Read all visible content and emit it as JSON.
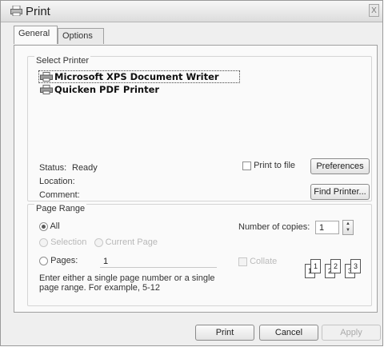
{
  "window": {
    "title": "Print",
    "close_label": "X"
  },
  "tabs": [
    {
      "label": "General",
      "active": true
    },
    {
      "label": "Options",
      "active": false
    }
  ],
  "select_printer": {
    "label": "Select Printer",
    "printers": [
      {
        "name": "Microsoft XPS Document Writer",
        "selected": true
      },
      {
        "name": "Quicken PDF Printer",
        "selected": false
      }
    ],
    "status_label": "Status:",
    "status_value": "Ready",
    "location_label": "Location:",
    "comment_label": "Comment:",
    "print_to_file_label": "Print to file",
    "preferences_label": "Preferences",
    "find_printer_label": "Find Printer..."
  },
  "page_range": {
    "label": "Page Range",
    "all_label": "All",
    "selection_label": "Selection",
    "current_page_label": "Current Page",
    "pages_label": "Pages:",
    "pages_value": "1",
    "hint": "Enter either a single page number or a single page range.  For example, 5-12",
    "selected": "all"
  },
  "copies": {
    "label": "Number of copies:",
    "value": "1",
    "collate_label": "Collate",
    "collate_sheets": [
      "1",
      "1",
      "2",
      "2",
      "3",
      "3"
    ]
  },
  "buttons": {
    "print": "Print",
    "cancel": "Cancel",
    "apply": "Apply"
  },
  "icons": {
    "title": "printer-icon",
    "printer": "printer-icon",
    "spin_up": "▲",
    "spin_down": "▼"
  }
}
